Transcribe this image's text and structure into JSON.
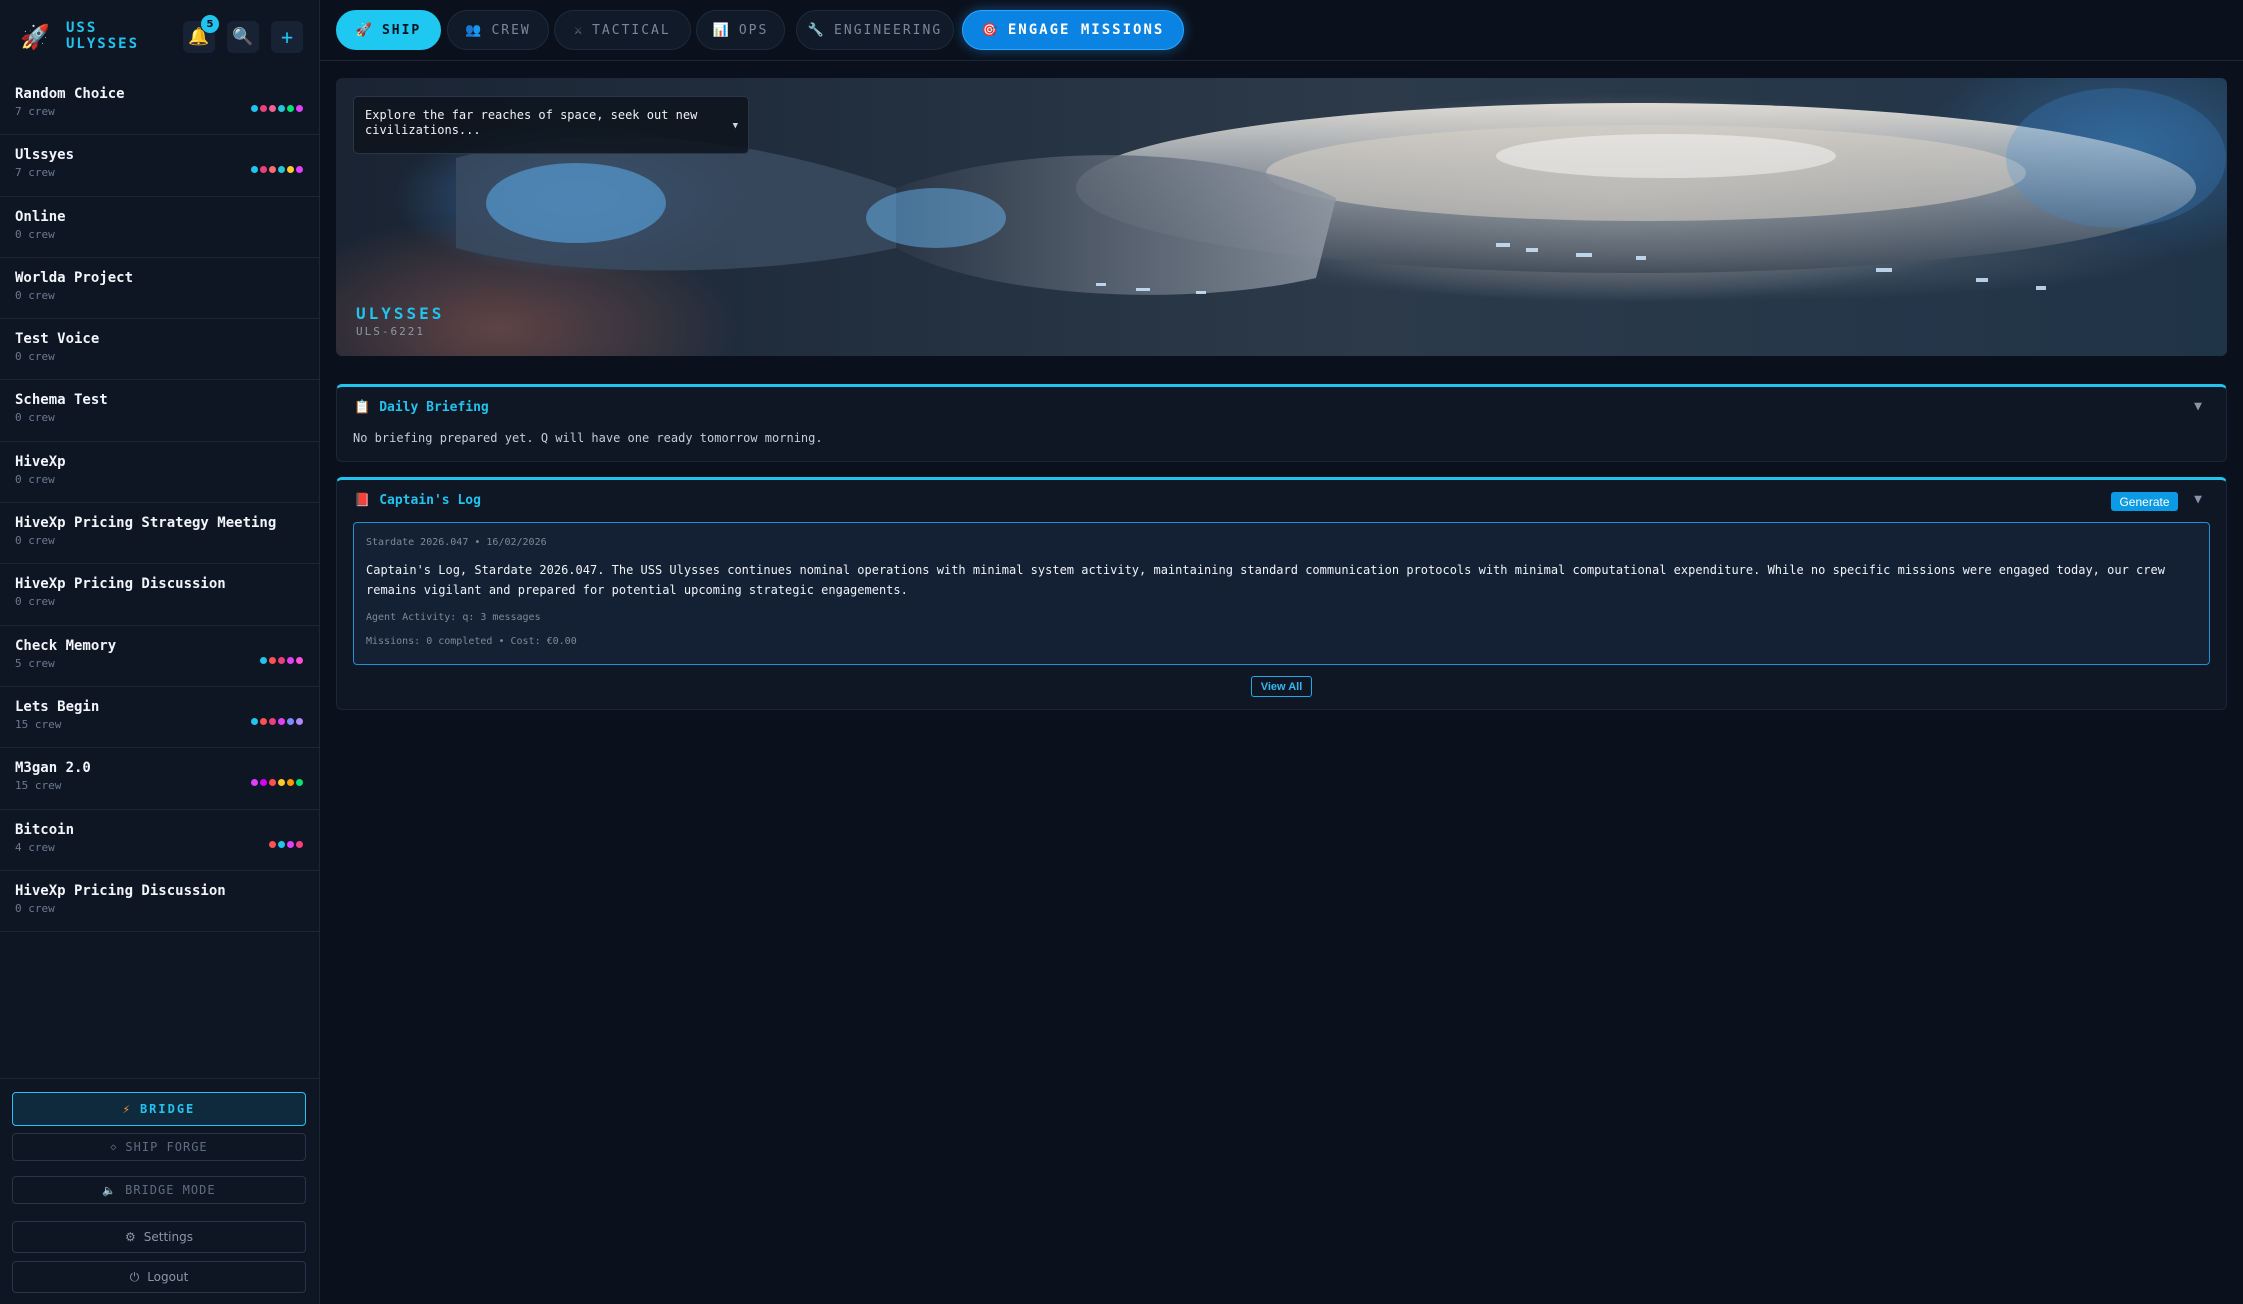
{
  "brand": {
    "title": "USS ULYSSES",
    "notifications": "5"
  },
  "projects": [
    {
      "name": "Random Choice",
      "crew": "7 crew",
      "dots": [
        "#22c3ee",
        "#ec407a",
        "#f06292",
        "#26c6da",
        "#00e676",
        "#e040fb"
      ]
    },
    {
      "name": "Ulssyes",
      "crew": "7 crew",
      "dots": [
        "#22c3ee",
        "#ec407a",
        "#ff6e6e",
        "#26c6da",
        "#ffca28",
        "#e040fb"
      ]
    },
    {
      "name": "Online",
      "crew": "0 crew",
      "dots": []
    },
    {
      "name": "Worlda Project",
      "crew": "0 crew",
      "dots": []
    },
    {
      "name": "Test Voice",
      "crew": "0 crew",
      "dots": []
    },
    {
      "name": "Schema Test",
      "crew": "0 crew",
      "dots": []
    },
    {
      "name": "HiveXp",
      "crew": "0 crew",
      "dots": []
    },
    {
      "name": "HiveXp Pricing Strategy Meeting",
      "crew": "0 crew",
      "dots": []
    },
    {
      "name": "HiveXp Pricing Discussion",
      "crew": "0 crew",
      "dots": []
    },
    {
      "name": "Check Memory",
      "crew": "5 crew",
      "dots": [
        "#22c3ee",
        "#ff5252",
        "#ec407a",
        "#e040fb",
        "#ff4fd8"
      ]
    },
    {
      "name": "Lets Begin",
      "crew": "15 crew",
      "dots": [
        "#22c3ee",
        "#ff5252",
        "#ec407a",
        "#e040fb",
        "#7c8cff",
        "#b388ff"
      ]
    },
    {
      "name": "M3gan 2.0",
      "crew": "15 crew",
      "dots": [
        "#e040fb",
        "#d500f9",
        "#ff5252",
        "#ffca28",
        "#ff9800",
        "#00e676"
      ]
    },
    {
      "name": "Bitcoin",
      "crew": "4 crew",
      "dots": [
        "#ff5252",
        "#22c3ee",
        "#e040fb",
        "#ff4081"
      ]
    },
    {
      "name": "HiveXp Pricing Discussion",
      "crew": "0 crew",
      "dots": []
    }
  ],
  "footer": {
    "bridge": "BRIDGE",
    "ship_forge": "SHIP FORGE",
    "bridge_mode": "BRIDGE MODE",
    "settings": "Settings",
    "logout": "Logout"
  },
  "tabs": {
    "ship": "SHIP",
    "crew": "CREW",
    "tactical": "TACTICAL",
    "ops": "OPS",
    "engineering": "ENGINEERING",
    "engage": "ENGAGE MISSIONS"
  },
  "hero": {
    "mission_select": "Explore the far reaches of space, seek out new civilizations...",
    "ship_name": "ULYSSES",
    "ship_code": "ULS-6221"
  },
  "briefing": {
    "title": "Daily Briefing",
    "text": "No briefing prepared yet. Q will have one ready tomorrow morning."
  },
  "captains_log": {
    "title": "Captain's Log",
    "generate": "Generate",
    "date": "Stardate 2026.047 • 16/02/2026",
    "body": "Captain's Log, Stardate 2026.047. The USS Ulysses continues nominal operations with minimal system activity, maintaining standard communication protocols with minimal computational expenditure. While no specific missions were engaged today, our crew remains vigilant and prepared for potential upcoming strategic engagements.",
    "activity": "Agent Activity: q: 3 messages",
    "missions": "Missions: 0 completed • Cost: €0.00",
    "view_all": "View All"
  },
  "colors": {
    "accent": "#22c3ee",
    "engage": "#0b83e3",
    "background": "#0b111c"
  }
}
